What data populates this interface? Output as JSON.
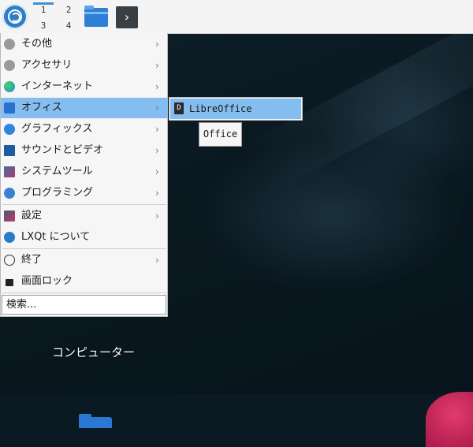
{
  "panel": {
    "desktops": [
      "1",
      "2",
      "3",
      "4"
    ],
    "active_desktop": "1"
  },
  "menu": {
    "items": [
      {
        "label": "その他",
        "icon": "ellipsis-icon",
        "has_submenu": true
      },
      {
        "label": "アクセサリ",
        "icon": "ellipsis-icon",
        "has_submenu": true
      },
      {
        "label": "インターネット",
        "icon": "globe-icon",
        "has_submenu": true
      },
      {
        "label": "オフィス",
        "icon": "office-icon",
        "has_submenu": true,
        "highlighted": true
      },
      {
        "label": "グラフィックス",
        "icon": "graphics-icon",
        "has_submenu": true
      },
      {
        "label": "サウンドとビデオ",
        "icon": "monitor-icon",
        "has_submenu": true
      },
      {
        "label": "システムツール",
        "icon": "system-tools-icon",
        "has_submenu": true
      },
      {
        "label": "プログラミング",
        "icon": "programming-icon",
        "has_submenu": true
      },
      {
        "label": "設定",
        "icon": "settings-icon",
        "has_submenu": true
      },
      {
        "label": "LXQt について",
        "icon": "lxqt-icon",
        "has_submenu": false
      },
      {
        "label": "終了",
        "icon": "power-icon",
        "has_submenu": true
      },
      {
        "label": "画面ロック",
        "icon": "lock-icon",
        "has_submenu": false
      }
    ],
    "search_label": "検索..."
  },
  "submenu": {
    "items": [
      {
        "label": "LibreOffice",
        "icon": "libreoffice-icon"
      }
    ]
  },
  "tooltip": "Office",
  "desktop": {
    "icon_label": "コンピューター"
  },
  "colors": {
    "highlight": "#84bdf0",
    "accent": "#3d8fd8"
  }
}
